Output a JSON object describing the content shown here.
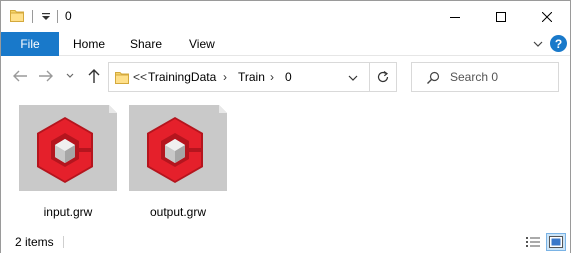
{
  "window": {
    "title": "0",
    "controls": {
      "minimize": "minimize-icon",
      "maximize": "maximize-icon",
      "close": "close-icon"
    }
  },
  "ribbon": {
    "file": "File",
    "tabs": [
      "Home",
      "Share",
      "View"
    ],
    "help": "?"
  },
  "nav": {
    "breadcrumb_prefix": "<<",
    "breadcrumb": [
      "TrainingData",
      "Train",
      "0"
    ],
    "search_placeholder": "Search 0"
  },
  "files": [
    {
      "name": "input.grw",
      "icon": "grw-file-icon"
    },
    {
      "name": "output.grw",
      "icon": "grw-file-icon"
    }
  ],
  "status": {
    "count": "2 items"
  },
  "colors": {
    "accent": "#1979ca",
    "icon_red": "#e5202b",
    "icon_dark_red": "#b5151e",
    "thumb_bg": "#c9c9c9",
    "folder": "#f5d56b"
  }
}
